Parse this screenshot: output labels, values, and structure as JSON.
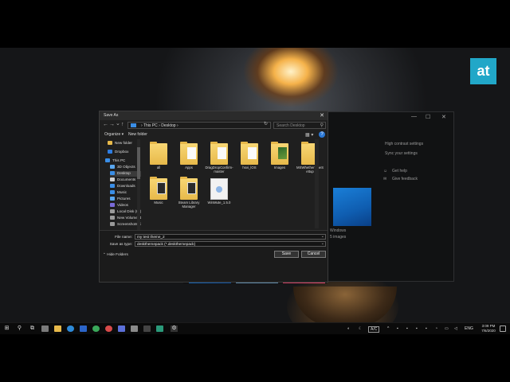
{
  "brand": {
    "logo_text": "at",
    "logo_color": "#21a7c8"
  },
  "settings_window": {
    "controls": [
      "—",
      "☐",
      "✕"
    ],
    "links": [
      "High contrast settings",
      "Sync your settings"
    ],
    "help_items": [
      "Get help",
      "Give feedback"
    ],
    "preview_label": "Windows",
    "preview_sub": "5 images"
  },
  "dialog": {
    "title": "Save As",
    "close_glyph": "✕",
    "nav": {
      "back": "←",
      "forward": "→",
      "up_chevron": "⌄",
      "up": "↑"
    },
    "address": {
      "parts": [
        "›",
        "This PC",
        "›",
        "Desktop",
        "›"
      ]
    },
    "refresh_glyph": "↻",
    "search_placeholder": "Search Desktop",
    "toolbar": {
      "organize": "Organize ▾",
      "new_folder": "New folder",
      "view_glyph": "▦ ▾",
      "help_glyph": "?"
    },
    "sidebar": [
      {
        "label": "New folder",
        "icon_color": "#e7b94a"
      },
      {
        "label": "Dropbox",
        "icon_color": "#2e7de1"
      },
      {
        "label": "This PC",
        "icon_color": "#3a8ee6"
      },
      {
        "label": "3D Objects",
        "icon_color": "#5aa7ef"
      },
      {
        "label": "Desktop",
        "icon_color": "#3a8ee6"
      },
      {
        "label": "Documents",
        "icon_color": "#cfcfcf"
      },
      {
        "label": "Downloads",
        "icon_color": "#3a8ee6"
      },
      {
        "label": "Music",
        "icon_color": "#3a8ee6"
      },
      {
        "label": "Pictures",
        "icon_color": "#5aa7ef"
      },
      {
        "label": "Videos",
        "icon_color": "#7a6ad8"
      },
      {
        "label": "Local Disk (C:)",
        "icon_color": "#9a9a9a"
      },
      {
        "label": "New Volume (D:)",
        "icon_color": "#9a9a9a"
      },
      {
        "label": "Screenshots (\\\\",
        "icon_color": "#9a9a9a"
      }
    ],
    "files": [
      {
        "label": "all",
        "kind": "folder"
      },
      {
        "label": "Apps",
        "kind": "folder-doc"
      },
      {
        "label": "DragDropConfirm-master",
        "kind": "folder-doc"
      },
      {
        "label": "hsvi_lOS",
        "kind": "folder-doc"
      },
      {
        "label": "Images",
        "kind": "folder-img"
      },
      {
        "label": "MSWhetheremeS ettup",
        "kind": "folder"
      },
      {
        "label": "Music",
        "kind": "folder-dark"
      },
      {
        "label": "Steam Library Manager",
        "kind": "folder-dark"
      },
      {
        "label": "WinMute_1.5.0",
        "kind": "file"
      }
    ],
    "file_name_label": "File name:",
    "file_name_value": "my test theme_2",
    "save_type_label": "Save as type:",
    "save_type_value": "deskthemepack (*.deskthemepack)",
    "dropdown_glyph": "⌄",
    "hide_folders": "⌃ Hide Folders",
    "save_button": "Save",
    "cancel_button": "Cancel"
  },
  "taskbar": {
    "start_glyph": "⊞",
    "search_glyph": "⚲",
    "taskview_glyph": "⧉",
    "tray_caret": "^",
    "language": "ENG",
    "clock_time": "3:09 PM",
    "clock_date": "7/6/2020",
    "accent": "#0b0b0b"
  }
}
